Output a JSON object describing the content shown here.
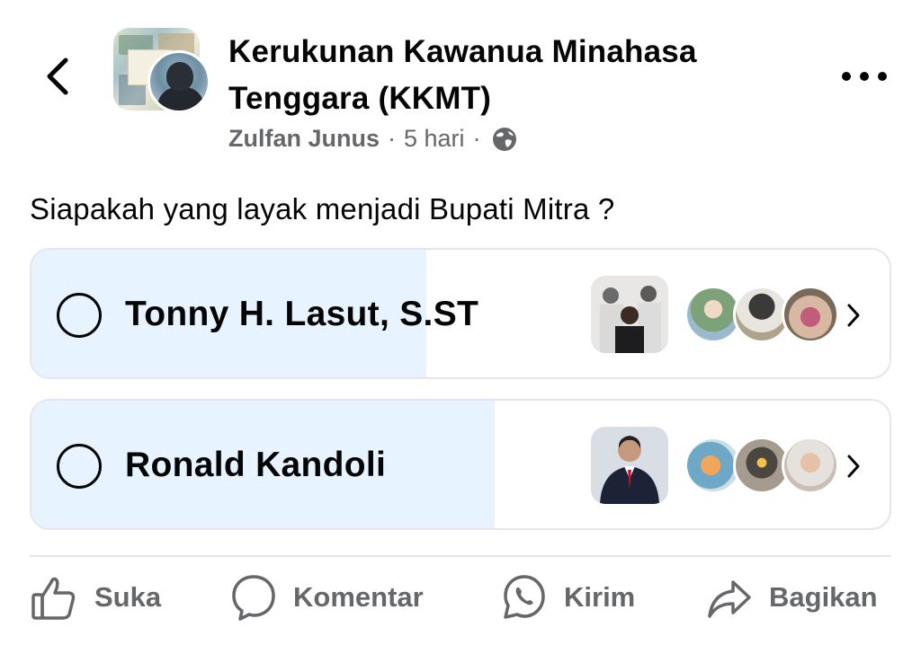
{
  "header": {
    "back_icon": "chevron-left-icon",
    "group_name": "Kerukunan Kawanua Minahasa Tenggara (KKMT)",
    "author": "Zulfan Junus",
    "separator": "·",
    "time": "5 hari",
    "privacy_icon": "globe-icon",
    "more_icon": "more-horizontal-icon"
  },
  "post": {
    "question": "Siapakah yang layak menjadi Bupati Mitra ?"
  },
  "poll": {
    "options": [
      {
        "label": "Tonny H. Lasut, S.ST",
        "fill_fraction": 0.46
      },
      {
        "label": "Ronald Kandoli",
        "fill_fraction": 0.54
      }
    ]
  },
  "actions": {
    "like": "Suka",
    "comment": "Komentar",
    "send": "Kirim",
    "share": "Bagikan"
  },
  "colors": {
    "poll_fill": "#e7f3ff",
    "text": "#050505",
    "muted": "#65676b",
    "border": "#e4e6eb"
  }
}
